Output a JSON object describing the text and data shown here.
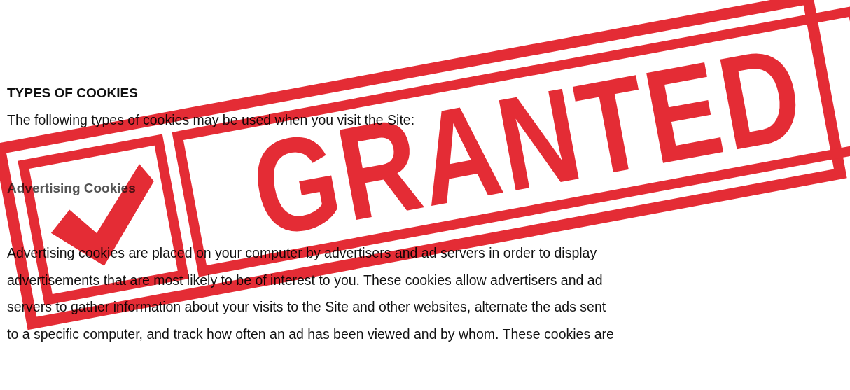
{
  "heading": "TYPES OF COOKIES",
  "intro": "The following types of cookies may be used when you visit the Site:",
  "section": {
    "title": "Advertising Cookies",
    "lines": [
      "Advertising cookies are placed on your computer by advertisers and ad servers in order to display",
      "advertisements that are most likely to be of interest to you. These cookies allow advertisers and ad",
      "servers to gather information about your visits to the Site and other websites, alternate the ads sent",
      "to a specific computer, and track how often an ad has been viewed and by whom. These cookies are"
    ]
  },
  "stamp": {
    "text": "GRANTED",
    "checked": true
  }
}
